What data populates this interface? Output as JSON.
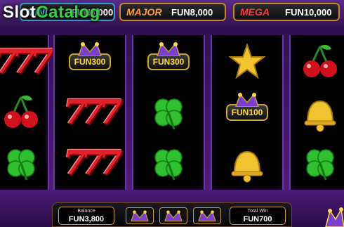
{
  "watermark": {
    "part1": "Slot",
    "part2": "Catalog"
  },
  "jackpots": {
    "mini": {
      "name": "MINI",
      "value": "FUN3,000"
    },
    "major": {
      "name": "MAJOR",
      "value": "FUN8,000"
    },
    "mega": {
      "name": "MEGA",
      "value": "FUN10,000"
    }
  },
  "reels": [
    [
      "sevens",
      "cherries",
      "clover"
    ],
    [
      "coin-fun300",
      "sevens",
      "sevens"
    ],
    [
      "coin-fun300",
      "clover",
      "clover"
    ],
    [
      "star",
      "coin-fun100",
      "bell"
    ],
    [
      "cherries",
      "bell",
      "clover"
    ]
  ],
  "coin_labels": {
    "fun300": "FUN300",
    "fun100": "FUN100"
  },
  "sevens_text": "777",
  "bottom": {
    "balance_label": "Balance",
    "balance_value": "FUN3,800",
    "total_win_label": "Total Win",
    "total_win_value": "FUN700"
  },
  "colors": {
    "seven_red": "#e0202a",
    "clover_green": "#2fbf2f",
    "bell_gold": "#f2c431",
    "cherry_red": "#d0101c",
    "coin_text": "#ffd84a"
  }
}
